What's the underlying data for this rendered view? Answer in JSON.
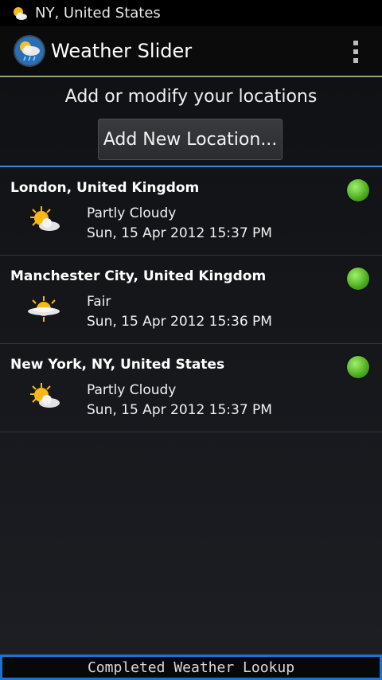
{
  "status_bar": {
    "text": "NY, United States",
    "icon": "partly-cloudy-icon"
  },
  "action_bar": {
    "title": "Weather Slider",
    "app_icon": "weather-slider-app-icon",
    "menu_icon": "overflow-menu-icon"
  },
  "main": {
    "header": "Add or modify your locations",
    "add_button_label": "Add New Location..."
  },
  "locations": [
    {
      "name": "London, United Kingdom",
      "condition": "Partly Cloudy",
      "datetime": "Sun, 15 Apr 2012 15:37 PM",
      "icon": "partly-cloudy-icon",
      "status_color": "#4caa1e"
    },
    {
      "name": "Manchester City, United Kingdom",
      "condition": "Fair",
      "datetime": "Sun, 15 Apr 2012 15:36 PM",
      "icon": "fair-icon",
      "status_color": "#4caa1e"
    },
    {
      "name": "New York, NY, United States",
      "condition": "Partly Cloudy",
      "datetime": "Sun, 15 Apr 2012 15:37 PM",
      "icon": "partly-cloudy-icon",
      "status_color": "#4caa1e"
    }
  ],
  "bottom_status": {
    "text": "Completed Weather Lookup"
  },
  "colors": {
    "accent_line": "#3f8ad8",
    "action_bar_line": "#8ea67a",
    "status_border": "#1a73d0"
  }
}
